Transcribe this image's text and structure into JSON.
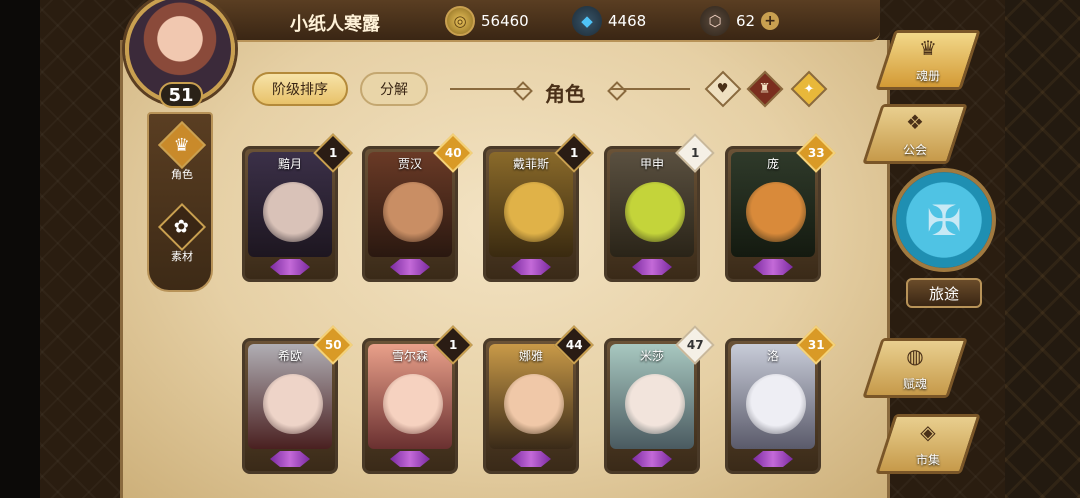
{
  "player": {
    "name": "小纸人寒露",
    "level": "51"
  },
  "currencies": [
    {
      "icon": "coin-icon",
      "glyph": "◎",
      "value": "56460"
    },
    {
      "icon": "blue-crystal-icon",
      "glyph": "◆",
      "value": "4468"
    },
    {
      "icon": "pink-crystal-icon",
      "glyph": "⬡",
      "value": "62"
    }
  ],
  "currency_plus": "+",
  "left_nav": [
    {
      "label": "角色",
      "glyph": "♛"
    },
    {
      "label": "素材",
      "glyph": "✿"
    }
  ],
  "header": {
    "sort_label": "阶级排序",
    "decompose_label": "分解",
    "title": "角色",
    "filters": [
      "♥",
      "♜",
      "✦"
    ]
  },
  "cards": [
    {
      "name": "黯月",
      "badge": "1",
      "badge_style": "dark",
      "art_top": "#3b3048",
      "art_bottom": "#1d1620",
      "face": "#d9c2b8"
    },
    {
      "name": "贾汉",
      "badge": "40",
      "badge_style": "gold",
      "art_top": "#6a3a26",
      "art_bottom": "#2a1810",
      "face": "#c98e64"
    },
    {
      "name": "戴菲斯",
      "badge": "1",
      "badge_style": "dark",
      "art_top": "#8a6a2a",
      "art_bottom": "#3a2a10",
      "face": "#e0b248"
    },
    {
      "name": "甲申",
      "badge": "1",
      "badge_style": "white",
      "art_top": "#5a5040",
      "art_bottom": "#2a2418",
      "face": "#c4d43a"
    },
    {
      "name": "庞",
      "badge": "33",
      "badge_style": "gold",
      "art_top": "#2f3a2a",
      "art_bottom": "#141a10",
      "face": "#d98a3a"
    },
    {
      "name": "希欧",
      "badge": "50",
      "badge_style": "gold",
      "art_top": "#b0aeb4",
      "art_bottom": "#4a2020",
      "face": "#eed4c8"
    },
    {
      "name": "雪尔森",
      "badge": "1",
      "badge_style": "dark",
      "art_top": "#e9a08a",
      "art_bottom": "#6a3030",
      "face": "#f6d2c0"
    },
    {
      "name": "娜雅",
      "badge": "44",
      "badge_style": "dark",
      "art_top": "#c99a48",
      "art_bottom": "#3a2a18",
      "face": "#f0c8a8"
    },
    {
      "name": "米莎",
      "badge": "47",
      "badge_style": "white",
      "art_top": "#a8c8c0",
      "art_bottom": "#4a5a60",
      "face": "#f2e4dc"
    },
    {
      "name": "洛",
      "badge": "31",
      "badge_style": "gold",
      "art_top": "#c8ccd8",
      "art_bottom": "#5a5a6a",
      "face": "#eeeeF4"
    }
  ],
  "right_menu": [
    {
      "label": "魂册",
      "glyph": "♛"
    },
    {
      "label": "公会",
      "glyph": "❖"
    },
    {
      "label": "赋魂",
      "glyph": "◍"
    },
    {
      "label": "市集",
      "glyph": "◈"
    }
  ],
  "journey": {
    "label": "旅途",
    "glyph": "✠"
  }
}
